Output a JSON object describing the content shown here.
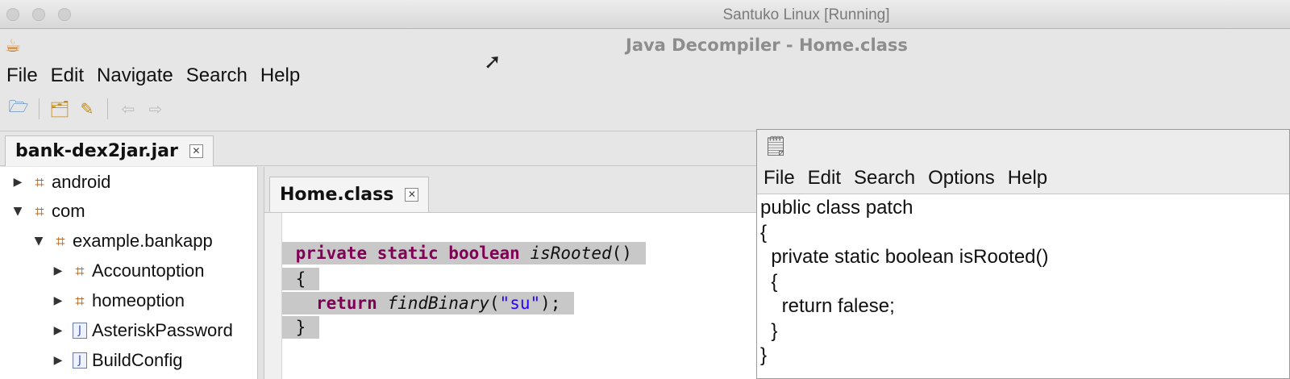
{
  "vm_window": {
    "title": "Santuko Linux [Running]"
  },
  "app": {
    "title": "Java Decompiler - Home.class",
    "menu": [
      "File",
      "Edit",
      "Navigate",
      "Search",
      "Help"
    ],
    "toolbar_icons": [
      "open-file-icon",
      "open-type-icon",
      "search-icon",
      "back-icon",
      "forward-icon"
    ]
  },
  "file_tab": {
    "label": "bank-dex2jar.jar"
  },
  "tree": [
    {
      "label": "android",
      "type": "package",
      "expanded": false,
      "level": 0
    },
    {
      "label": "com",
      "type": "package",
      "expanded": true,
      "level": 0
    },
    {
      "label": "example.bankapp",
      "type": "package",
      "expanded": true,
      "level": 1
    },
    {
      "label": "Accountoption",
      "type": "package",
      "expanded": false,
      "level": 2
    },
    {
      "label": "homeoption",
      "type": "package",
      "expanded": false,
      "level": 2
    },
    {
      "label": "AsteriskPassword",
      "type": "class",
      "expanded": false,
      "level": 2
    },
    {
      "label": "BuildConfig",
      "type": "class",
      "expanded": false,
      "level": 2
    }
  ],
  "editor_tab": {
    "label": "Home.class"
  },
  "code": {
    "line1": {
      "kw": "private static boolean",
      "name": "isRooted",
      "rest": "()"
    },
    "line2": "{",
    "line3": {
      "kw": "return",
      "name": "findBinary",
      "open": "(",
      "str": "\"su\"",
      "close": ");"
    },
    "line4": "}"
  },
  "notepad": {
    "menu": [
      "File",
      "Edit",
      "Search",
      "Options",
      "Help"
    ],
    "lines": [
      "public class patch",
      "{",
      "  private static boolean isRooted()",
      "  {",
      "    return falese;",
      "  }",
      "}"
    ]
  }
}
